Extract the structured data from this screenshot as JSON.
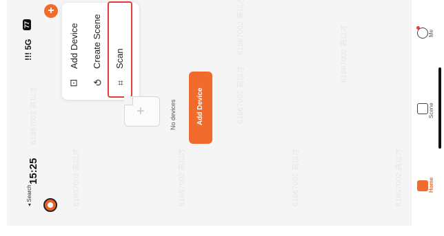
{
  "status_bar": {
    "time": "15:25",
    "back_label": "◂ Search",
    "signal": "!!! 5G",
    "battery": "77"
  },
  "menu": {
    "items": [
      {
        "label": "Add Device",
        "icon": "add-device-icon"
      },
      {
        "label": "Create Scene",
        "icon": "create-scene-icon"
      },
      {
        "label": "Scan",
        "icon": "scan-icon"
      }
    ]
  },
  "empty_state": {
    "message": "No devices",
    "button_label": "Add Device"
  },
  "watermark": {
    "text": "61867002 高以才"
  },
  "nav": {
    "items": [
      {
        "label": "Home",
        "icon": "home-icon",
        "active": true
      },
      {
        "label": "Scene",
        "icon": "scene-icon",
        "active": false
      },
      {
        "label": "Me",
        "icon": "me-icon",
        "active": false
      }
    ]
  },
  "colors": {
    "accent": "#f06b2c",
    "highlight": "#e63b3b"
  }
}
